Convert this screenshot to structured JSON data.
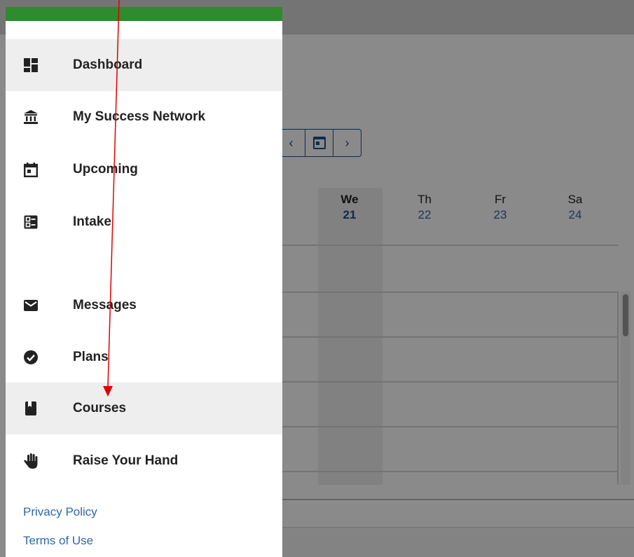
{
  "menu": {
    "items": [
      {
        "label": "Dashboard",
        "icon": "dashboard-icon"
      },
      {
        "label": "My Success Network",
        "icon": "institution-icon"
      },
      {
        "label": "Upcoming",
        "icon": "calendar-icon"
      },
      {
        "label": "Intake",
        "icon": "intake-form-icon"
      },
      {
        "label": "Messages",
        "icon": "envelope-icon"
      },
      {
        "label": "Plans",
        "icon": "check-circle-icon"
      },
      {
        "label": "Courses",
        "icon": "book-icon"
      },
      {
        "label": "Raise Your Hand",
        "icon": "hand-icon"
      }
    ],
    "active_item": "Courses"
  },
  "footer_links": {
    "privacy": "Privacy Policy",
    "terms": "Terms of Use"
  },
  "calendar": {
    "prev_symbol": "‹",
    "next_symbol": "›",
    "days": [
      {
        "name": "We",
        "num": "21",
        "today": true
      },
      {
        "name": "Th",
        "num": "22",
        "today": false
      },
      {
        "name": "Fr",
        "num": "23",
        "today": false
      },
      {
        "name": "Sa",
        "num": "24",
        "today": false
      }
    ]
  },
  "colors": {
    "brand_green": "#2e8b2e",
    "link_blue": "#2d68a8",
    "annotation_red": "#e00000"
  }
}
